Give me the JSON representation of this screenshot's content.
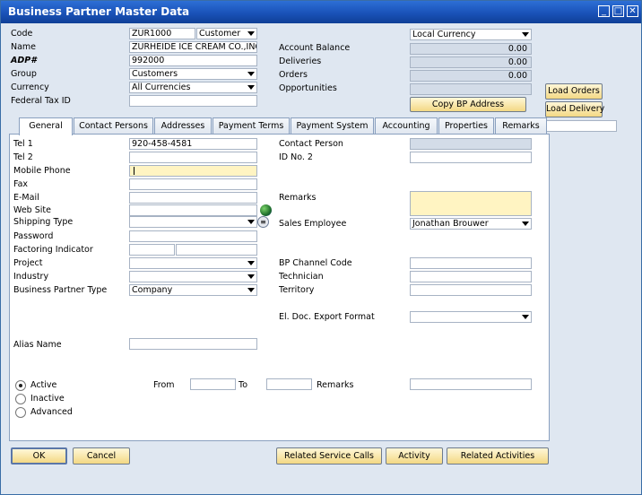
{
  "window": {
    "title": "Business Partner Master Data"
  },
  "header": {
    "code_label": "Code",
    "code_value": "ZUR1000",
    "type_value": "Customer",
    "name_label": "Name",
    "name_value": "ZURHEIDE ICE CREAM CO.,INC.",
    "adp_label": "ADP#",
    "adp_value": "992000",
    "group_label": "Group",
    "group_value": "Customers",
    "currency_label": "Currency",
    "currency_value": "All Currencies",
    "tax_label": "Federal Tax ID",
    "local_currency_value": "Local Currency",
    "balance_label": "Account Balance",
    "balance_value": "0.00",
    "deliveries_label": "Deliveries",
    "deliveries_value": "0.00",
    "orders_label": "Orders",
    "orders_value": "0.00",
    "opportunities_label": "Opportunities",
    "copy_bp_label": "Copy BP Address",
    "load_orders_label": "Load Orders",
    "load_delivery_label": "Load Delivery"
  },
  "tabs": [
    "General",
    "Contact Persons",
    "Addresses",
    "Payment Terms",
    "Payment System",
    "Accounting",
    "Properties",
    "Remarks"
  ],
  "general": {
    "tel1_label": "Tel 1",
    "tel1_value": "920-458-4581",
    "tel2_label": "Tel 2",
    "mobile_label": "Mobile Phone",
    "fax_label": "Fax",
    "email_label": "E-Mail",
    "website_label": "Web Site",
    "shipping_label": "Shipping Type",
    "password_label": "Password",
    "factoring_label": "Factoring Indicator",
    "project_label": "Project",
    "industry_label": "Industry",
    "bptype_label": "Business Partner Type",
    "bptype_value": "Company",
    "alias_label": "Alias Name",
    "contact_label": "Contact Person",
    "id2_label": "ID No. 2",
    "remarks_label": "Remarks",
    "sales_emp_label": "Sales Employee",
    "sales_emp_value": "Jonathan Brouwer",
    "bp_channel_label": "BP Channel Code",
    "technician_label": "Technician",
    "territory_label": "Territory",
    "eldoc_label": "El. Doc. Export Format",
    "active_label": "Active",
    "inactive_label": "Inactive",
    "advanced_label": "Advanced",
    "from_label": "From",
    "to_label": "To",
    "status_remarks_label": "Remarks",
    "status_selected": "Active"
  },
  "footer": {
    "ok_label": "OK",
    "cancel_label": "Cancel",
    "related_service_label": "Related Service Calls",
    "activity_label": "Activity",
    "related_activities_label": "Related Activities"
  },
  "colors": {
    "title_bar": "#1a52b8",
    "window_bg": "#dfe7f1",
    "button": "#f3d884",
    "field_highlight": "#fff4c2"
  }
}
